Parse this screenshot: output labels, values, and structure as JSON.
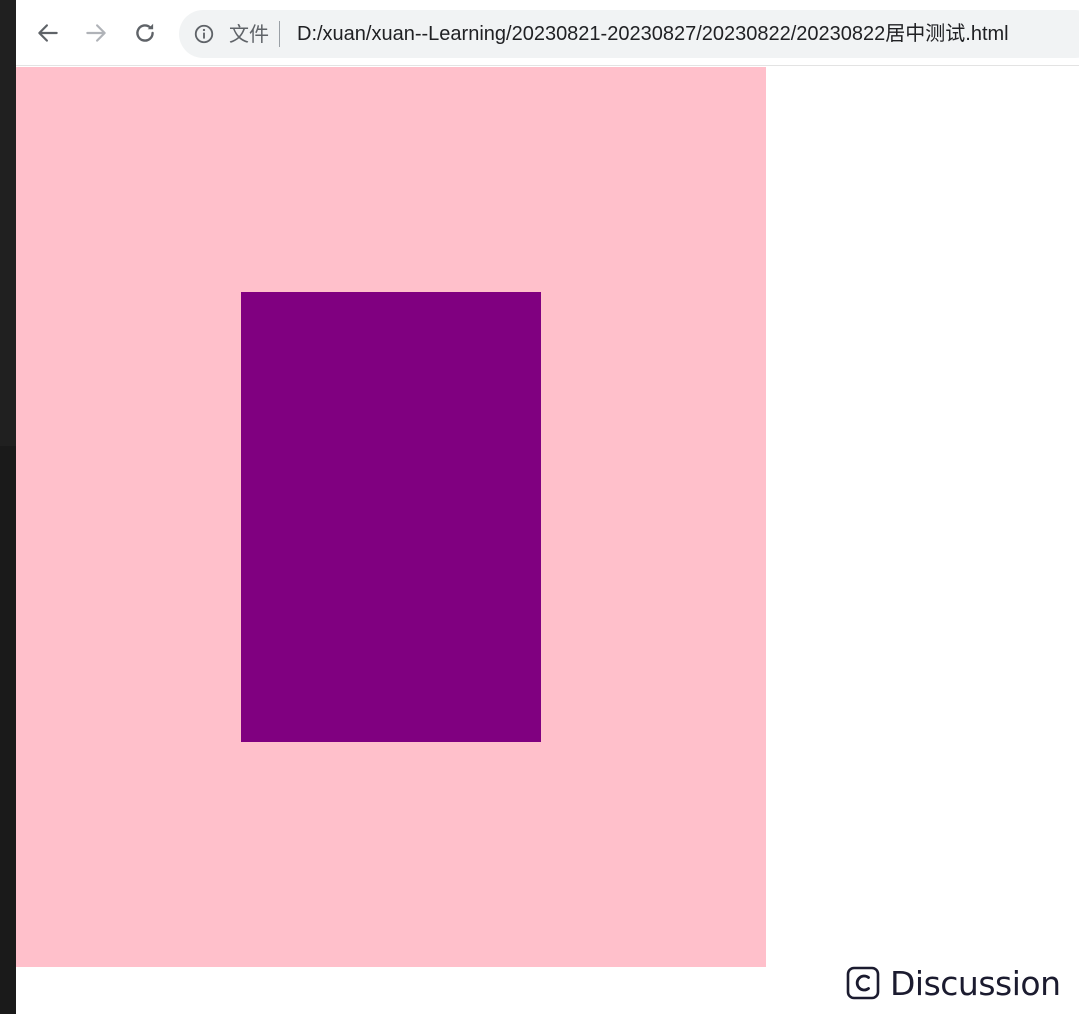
{
  "toolbar": {
    "back_icon": "arrow-left-icon",
    "forward_icon": "arrow-right-icon",
    "reload_icon": "reload-icon",
    "omnibox": {
      "info_icon": "info-icon",
      "scheme_label": "文件",
      "url": "D:/xuan/xuan--Learning/20230821-20230827/20230822/20230822居中测试.html"
    }
  },
  "page": {
    "outer_box_color": "#ffc0cb",
    "inner_box_color": "#800080"
  },
  "overlay": {
    "discussion_icon": "c-badge-icon",
    "discussion_label": "Discussion"
  }
}
